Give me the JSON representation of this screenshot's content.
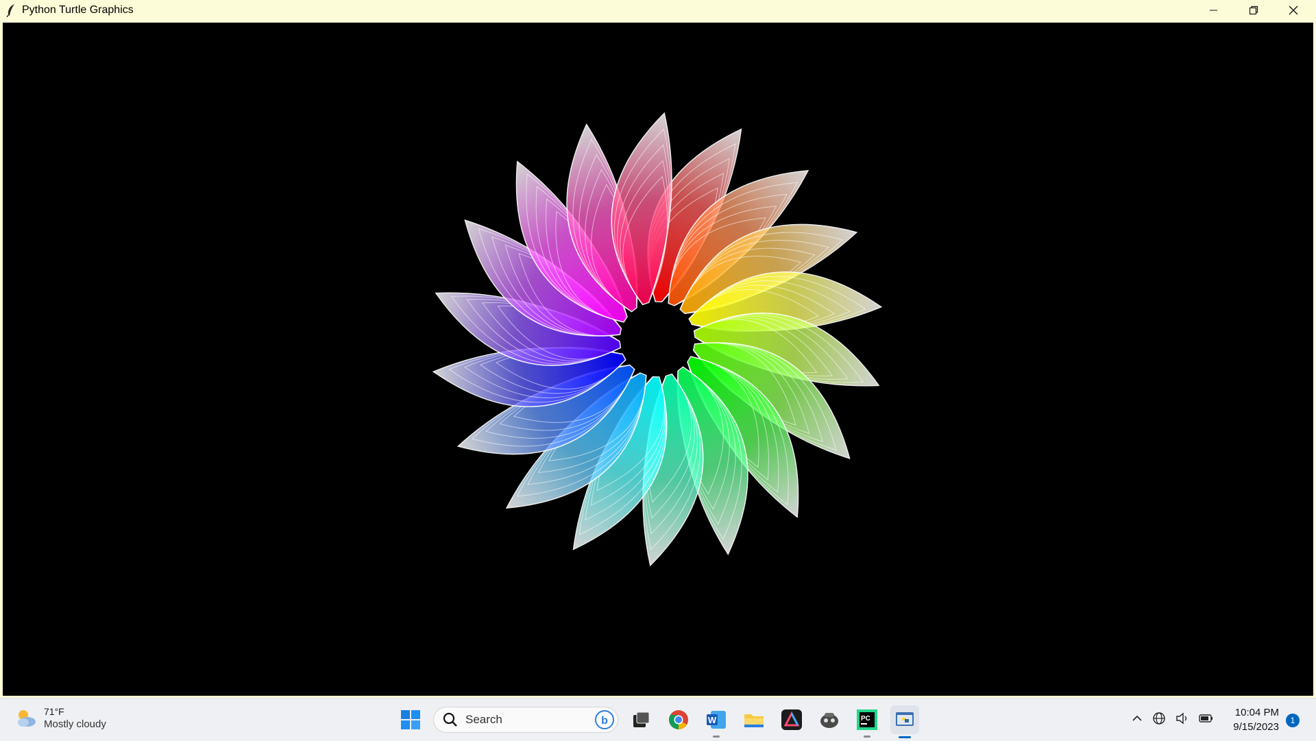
{
  "window": {
    "title": "Python Turtle Graphics",
    "controls": [
      "minimize-icon",
      "restore-icon",
      "close-icon"
    ]
  },
  "canvas": {
    "background": "#000000",
    "drawing": "rainbow-spiral-flower",
    "petal_count": 18,
    "outline_color": "#ffffff"
  },
  "taskbar": {
    "weather": {
      "temp": "71°F",
      "desc": "Mostly cloudy",
      "icon": "partly-cloudy-icon"
    },
    "search": {
      "label": "Search"
    },
    "apps": [
      {
        "name": "start-icon"
      },
      {
        "name": "bing-icon"
      },
      {
        "name": "task-view-icon"
      },
      {
        "name": "chrome-icon"
      },
      {
        "name": "word-icon"
      },
      {
        "name": "file-explorer-icon"
      },
      {
        "name": "affinity-icon"
      },
      {
        "name": "ollama-icon"
      },
      {
        "name": "pycharm-icon"
      },
      {
        "name": "python-turtle-icon"
      }
    ],
    "tray": {
      "icons": [
        "chevron-up-icon",
        "network-icon",
        "volume-icon",
        "battery-icon"
      ],
      "time": "10:04 PM",
      "date": "9/15/2023",
      "notifications": "1"
    }
  }
}
